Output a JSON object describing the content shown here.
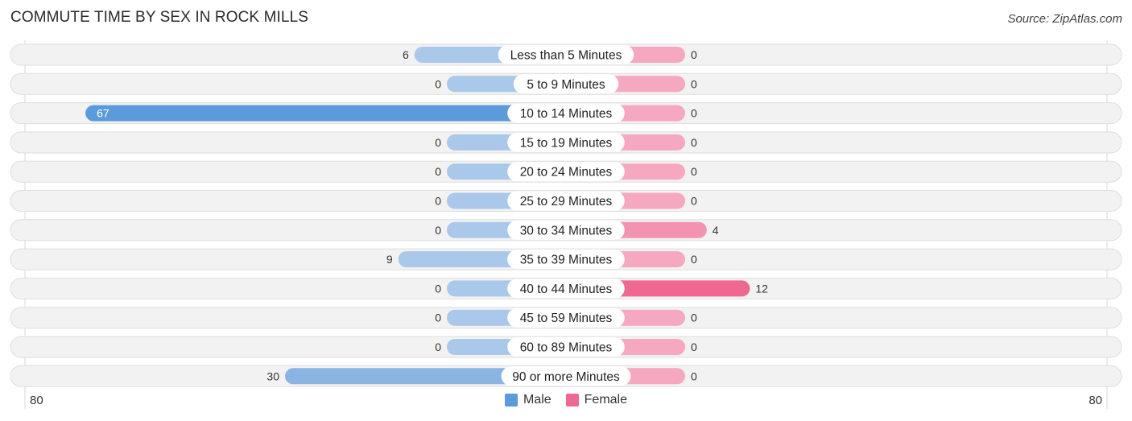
{
  "header": {
    "title": "COMMUTE TIME BY SEX IN ROCK MILLS",
    "source": "Source: ZipAtlas.com"
  },
  "colors": {
    "male_strong": "#5b9bdc",
    "male_light": "#a9c8ea",
    "female_strong": "#f06892",
    "female_light": "#f6a8c0",
    "row_bg": "#f2f2f2"
  },
  "chart_data": {
    "type": "bar",
    "orientation": "horizontal-diverging",
    "title": "COMMUTE TIME BY SEX IN ROCK MILLS",
    "categories": [
      "Less than 5 Minutes",
      "5 to 9 Minutes",
      "10 to 14 Minutes",
      "15 to 19 Minutes",
      "20 to 24 Minutes",
      "25 to 29 Minutes",
      "30 to 34 Minutes",
      "35 to 39 Minutes",
      "40 to 44 Minutes",
      "45 to 59 Minutes",
      "60 to 89 Minutes",
      "90 or more Minutes"
    ],
    "series": [
      {
        "name": "Male",
        "values": [
          6,
          0,
          67,
          0,
          0,
          0,
          0,
          9,
          0,
          0,
          0,
          30
        ]
      },
      {
        "name": "Female",
        "values": [
          0,
          0,
          0,
          0,
          0,
          0,
          4,
          0,
          12,
          0,
          0,
          0
        ]
      }
    ],
    "xlim": [
      -80,
      80
    ],
    "axis_labels": {
      "left": "80",
      "right": "80"
    },
    "legend": {
      "position": "bottom-center",
      "entries": [
        "Male",
        "Female"
      ]
    }
  }
}
